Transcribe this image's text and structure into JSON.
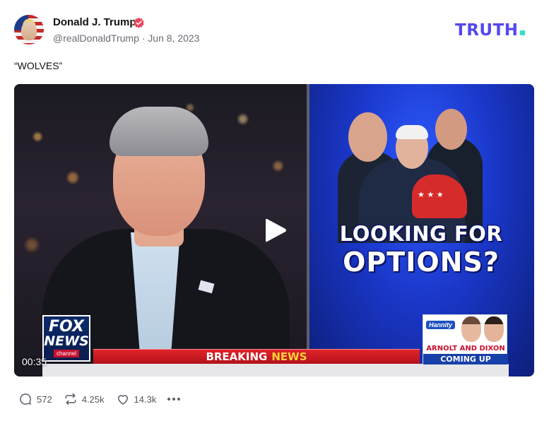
{
  "post": {
    "author_name": "Donald J. Trump",
    "handle_date": "@realDonaldTrump · Jun 8, 2023",
    "text": "“WOLVES”",
    "brand": "TRUTH",
    "verified_icon": "verified-badge-icon"
  },
  "video": {
    "timestamp": "00:35",
    "headline_line1": "LOOKING FOR",
    "headline_line2": "OPTIONS?",
    "network_line1": "FOX",
    "network_line2": "NEWS",
    "network_line3": "channel",
    "banner_word1": "BREAKING",
    "banner_word2": "NEWS",
    "promo_show": "Hannity",
    "promo_guests": "ARNOLT AND DIXON",
    "promo_sub": "COMING UP",
    "play_icon": "play-icon"
  },
  "actions": {
    "replies": "572",
    "retruths": "4.25k",
    "likes": "14.3k",
    "icons": [
      "reply-icon",
      "retruth-icon",
      "like-icon",
      "more-icon"
    ]
  },
  "colors": {
    "brand": "#5448ee",
    "brand_dot": "#2fe0c8",
    "verified": "#e8465a",
    "banner_red": "#e0242a",
    "banner_yellow": "#ffd23a"
  }
}
